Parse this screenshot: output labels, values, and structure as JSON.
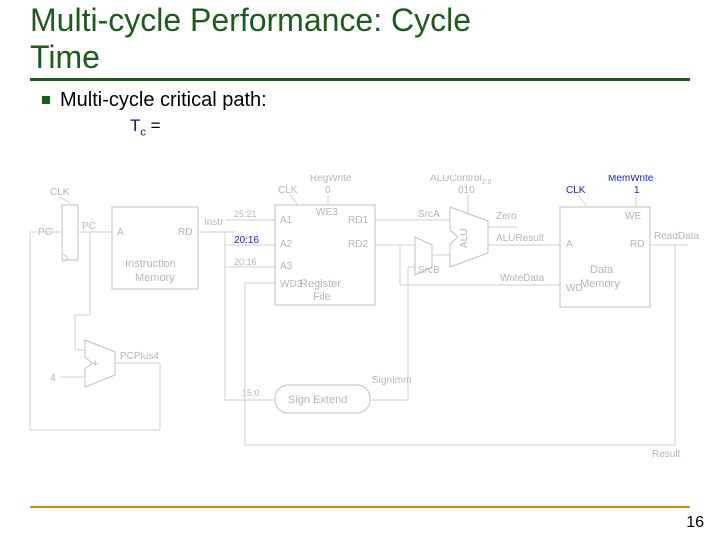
{
  "title_line1": "Multi-cycle Performance: Cycle",
  "title_line2": "Time",
  "bullet": "Multi-cycle critical path:",
  "formula": {
    "sym": "T",
    "sub": "c",
    "eq": " ="
  },
  "page": "16",
  "signals": {
    "clk": "CLK",
    "pc": "PC",
    "pcprime": "PC'",
    "a": "A",
    "rd": "RD",
    "instr": "Instr",
    "imem1": "Instruction",
    "imem2": "Memory",
    "a1": "A1",
    "a2": "A2",
    "a3": "A3",
    "wd3": "WD3",
    "we3": "WE3",
    "rd1": "RD1",
    "rd2": "RD2",
    "rfile1": "Register",
    "rfile2": "File",
    "regwrite": "RegWrite",
    "regwrite_v": "0",
    "aluctrl": "ALUControl",
    "aluctrl_sub": "2:0",
    "aluctrl_v": "010",
    "srca": "SrcA",
    "srcb": "SrcB",
    "alu": "ALU",
    "zero": "Zero",
    "alures": "ALUResult",
    "writedata": "WriteData",
    "memwrite": "MemWrite",
    "memwrite_v": "1",
    "we": "WE",
    "rd_d": "RD",
    "a_d": "A",
    "wd": "WD",
    "dmem1": "Data",
    "dmem2": "Memory",
    "readdata": "ReadData",
    "pcplus4": "PCPlus4",
    "plus": "+",
    "four": "4",
    "signimm": "SignImm",
    "signext": "Sign Extend",
    "b2521": "25:21",
    "b2016a": "20:16",
    "b2016b": "20:16",
    "b150": "15:0",
    "result": "Result"
  },
  "chart_data": {
    "type": "schematic",
    "description": "Single/multi-cycle MIPS datapath with Instruction Memory, Register File, ALU, Data Memory, PC+4 adder, Sign Extend",
    "blocks": [
      {
        "name": "PC register",
        "inputs": [
          "PC'",
          "CLK"
        ],
        "outputs": [
          "PC"
        ]
      },
      {
        "name": "Instruction Memory",
        "inputs": [
          "A"
        ],
        "outputs": [
          "RD -> Instr"
        ]
      },
      {
        "name": "Register File",
        "inputs": [
          "A1 (Instr[25:21])",
          "A2 (Instr[20:16])",
          "A3 (Instr[20:16])",
          "WD3",
          "WE3 (RegWrite)",
          "CLK"
        ],
        "outputs": [
          "RD1",
          "RD2"
        ]
      },
      {
        "name": "ALU",
        "inputs": [
          "SrcA",
          "SrcB",
          "ALUControl[2:0]"
        ],
        "outputs": [
          "Zero",
          "ALUResult"
        ]
      },
      {
        "name": "Data Memory",
        "inputs": [
          "A",
          "WD (WriteData)",
          "WE (MemWrite)",
          "CLK"
        ],
        "outputs": [
          "RD -> ReadData"
        ]
      },
      {
        "name": "Adder",
        "inputs": [
          "PC",
          "4"
        ],
        "outputs": [
          "PCPlus4"
        ]
      },
      {
        "name": "Sign Extend",
        "inputs": [
          "Instr[15:0]"
        ],
        "outputs": [
          "SignImm"
        ]
      }
    ],
    "control_values": {
      "RegWrite": "0",
      "ALUControl": "010",
      "MemWrite": "1"
    }
  }
}
